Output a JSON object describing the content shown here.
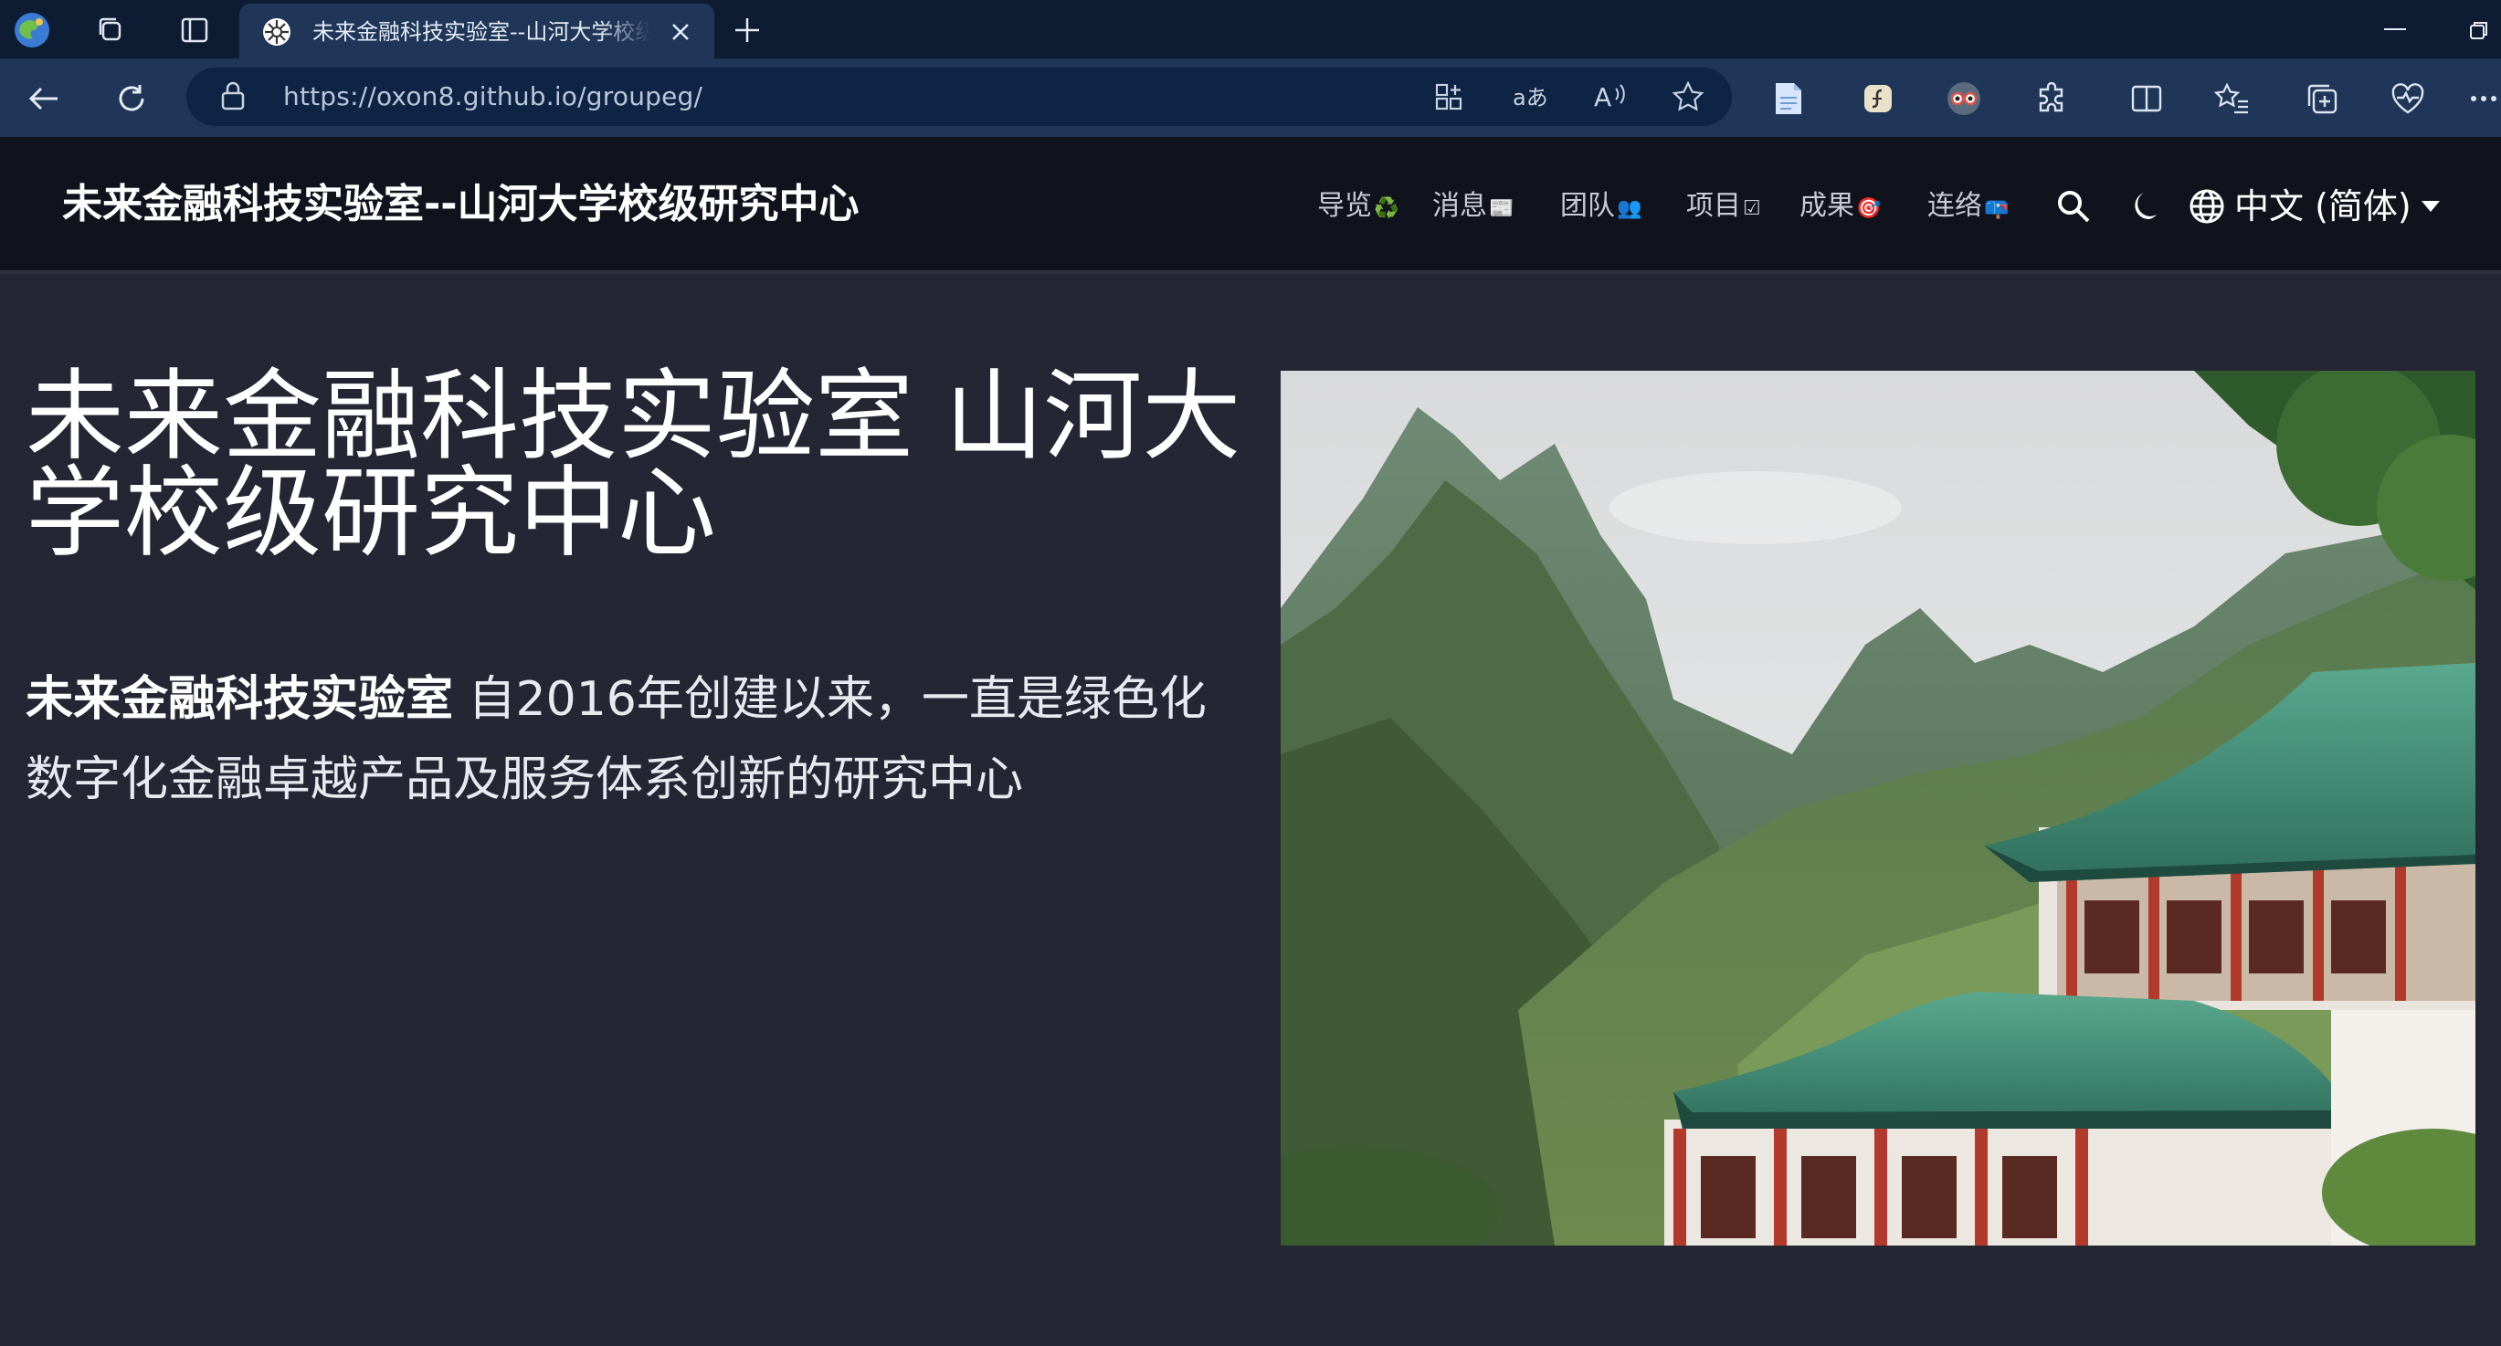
{
  "browser": {
    "tab_title": "未来金融科技实验室--山河大学校级研究中心",
    "url": "https://oxon8.github.io/groupeg/",
    "url_host": "https://oxon8.github.io",
    "url_path": "/groupeg/",
    "omnibox_icons": [
      "app-available-icon",
      "translate-icon",
      "read-aloud-icon",
      "favorite-star-icon"
    ],
    "toolbar_icons": [
      "notes-icon",
      "script-icon",
      "avatar-ext-icon",
      "extensions-icon",
      "split-screen-icon",
      "favorites-icon",
      "collections-icon",
      "browser-essentials-icon",
      "more-icon"
    ]
  },
  "site": {
    "title": "未来金融科技实验室--山河大学校级研究中心",
    "nav": [
      {
        "label": "导览",
        "emoji": "♻️"
      },
      {
        "label": "消息",
        "emoji": "📰"
      },
      {
        "label": "团队",
        "emoji": "👥"
      },
      {
        "label": "项目",
        "emoji": "☑"
      },
      {
        "label": "成果",
        "emoji": "🎯"
      },
      {
        "label": "连络",
        "emoji": "📪"
      }
    ],
    "language": "中文 (简体)"
  },
  "hero": {
    "heading": "未来金融科技实验室 山河大学校级研究中心",
    "lead_bold": "未来金融科技实验室",
    "lead_rest": " 自2016年创建以来，一直是绿色化数字化金融卓越产品及服务体系创新的研究中心",
    "image_alt": "mountain-temple-illustration"
  },
  "colors": {
    "tabbar_bg": "#0d1b33",
    "toolbar_bg": "#1f3658",
    "header_bg": "#11131c",
    "page_bg": "#242633",
    "roof_green": "#3f8a73",
    "pillar_red": "#b23a2c"
  }
}
